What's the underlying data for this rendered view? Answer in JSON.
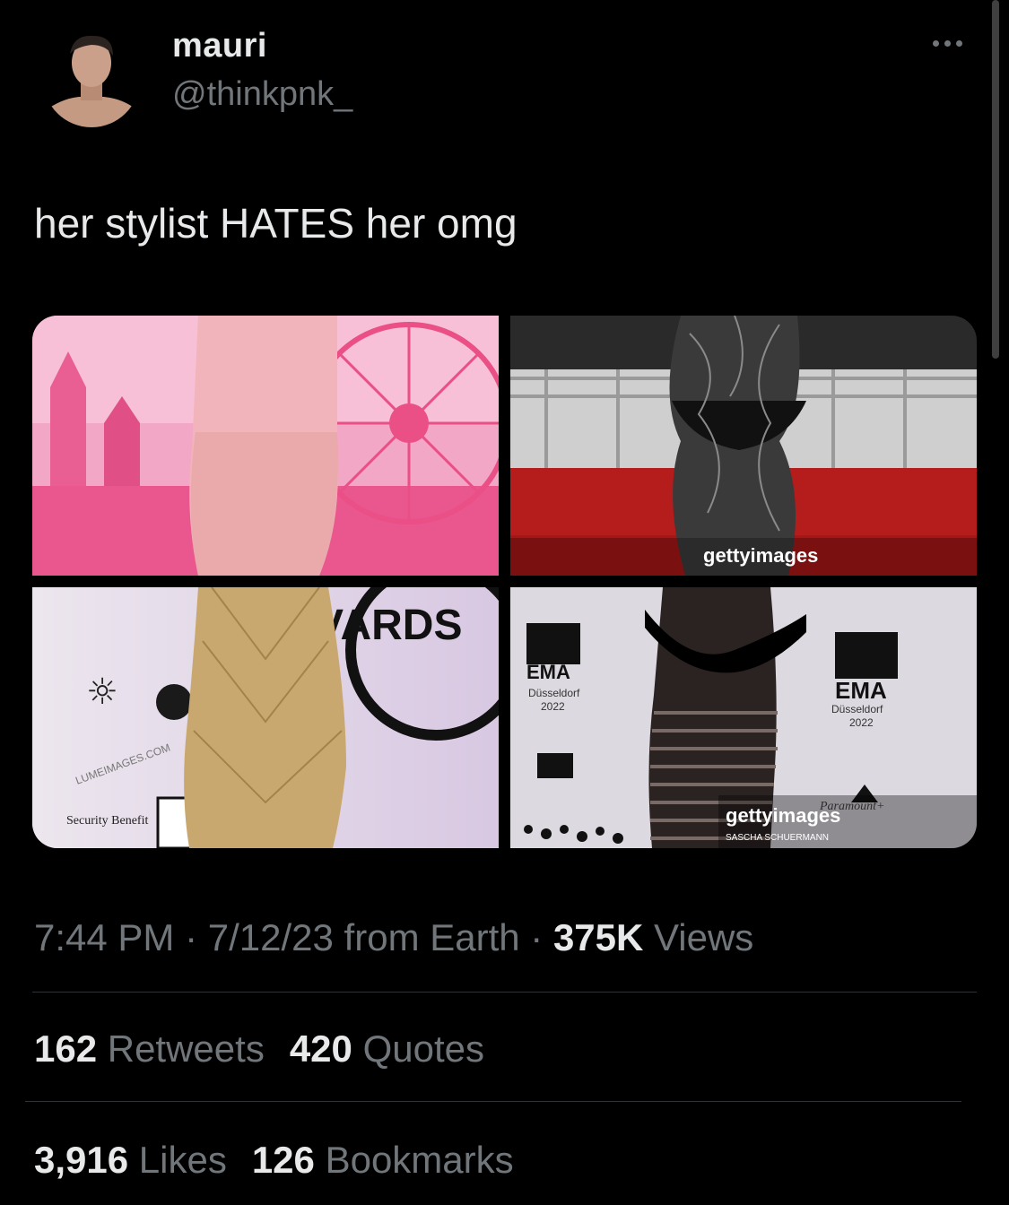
{
  "author": {
    "name": "mauri",
    "handle": "@thinkpnk_"
  },
  "tweet": {
    "text": "her stylist HATES her omg"
  },
  "media": {
    "tile1": {
      "description_icon": "photo"
    },
    "tile2": {
      "watermark": "gettyimages"
    },
    "tile3": {
      "sign_text": "VARDS",
      "logo1": "Security Benefit",
      "watermark": "LUMEIMAGES.COM"
    },
    "tile4": {
      "logo_ema": "EMA",
      "city": "Düsseldorf",
      "year": "2022",
      "watermark": "gettyimages",
      "credit": "SASCHA SCHUERMANN",
      "paramount": "Paramount+"
    }
  },
  "meta": {
    "time": "7:44 PM",
    "sep1": " · ",
    "date": "7/12/23",
    "from": " from Earth",
    "sep2": " · ",
    "views_count": "375K",
    "views_label": " Views"
  },
  "stats": {
    "retweets_count": "162",
    "retweets_label": " Retweets",
    "quotes_count": "420",
    "quotes_label": " Quotes",
    "likes_count": "3,916",
    "likes_label": " Likes",
    "bookmarks_count": "126",
    "bookmarks_label": " Bookmarks"
  },
  "colors": {
    "background": "#000000",
    "text": "#e7e9ea",
    "secondary": "#71767b",
    "divider": "#2f3336"
  }
}
